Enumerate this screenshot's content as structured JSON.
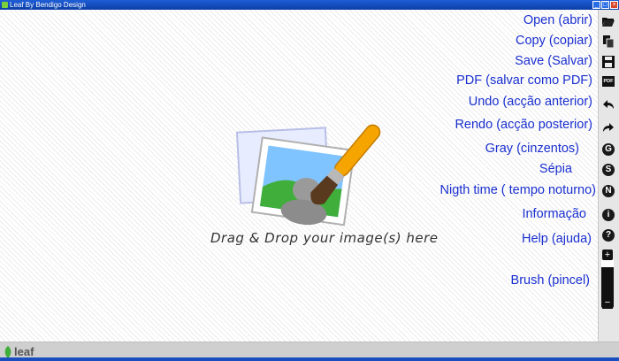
{
  "window": {
    "title": "Leaf By Bendigo Design",
    "controls": [
      "_",
      "□",
      "×"
    ]
  },
  "menu": [
    {
      "id": "open",
      "label": "Open (abrir)",
      "icon": "folder-open-icon"
    },
    {
      "id": "copy",
      "label": "Copy (copiar)",
      "icon": "copy-icon"
    },
    {
      "id": "save",
      "label": "Save (Salvar)",
      "icon": "floppy-disk-icon"
    },
    {
      "id": "pdf",
      "label": "PDF (salvar como PDF)",
      "icon": "pdf-icon",
      "icon_text": "PDF"
    },
    {
      "id": "undo",
      "label": "Undo (acção anterior)",
      "icon": "undo-icon"
    },
    {
      "id": "redo",
      "label": "Rendo (acção posterior)",
      "icon": "redo-icon"
    },
    {
      "id": "gray",
      "label": "Gray (cinzentos)",
      "icon": "gray-filter-icon",
      "icon_text": "G"
    },
    {
      "id": "sepia",
      "label": "Sépia",
      "icon": "sepia-filter-icon",
      "icon_text": "S"
    },
    {
      "id": "night",
      "label": "Nigth time ( tempo noturno)",
      "icon": "night-filter-icon",
      "icon_text": "N"
    },
    {
      "id": "info",
      "label": "Informação",
      "icon": "info-icon",
      "icon_text": "i"
    },
    {
      "id": "help",
      "label": "Help (ajuda)",
      "icon": "help-icon",
      "icon_text": "?"
    },
    {
      "id": "brush",
      "label": "Brush (pincel)",
      "icon": "brush-size-slider"
    }
  ],
  "brush_slider": {
    "plus": "+",
    "minus": "−",
    "level": 0.15
  },
  "drop_zone": {
    "text": "Drag & Drop your image(s) here"
  },
  "status": {
    "logo_text": "leaf"
  },
  "colors": {
    "link": "#1a2fd0",
    "titlebar": "#0b3fa8",
    "toolbar": "#e6e6e6",
    "brush_handle": "#f5a400"
  }
}
